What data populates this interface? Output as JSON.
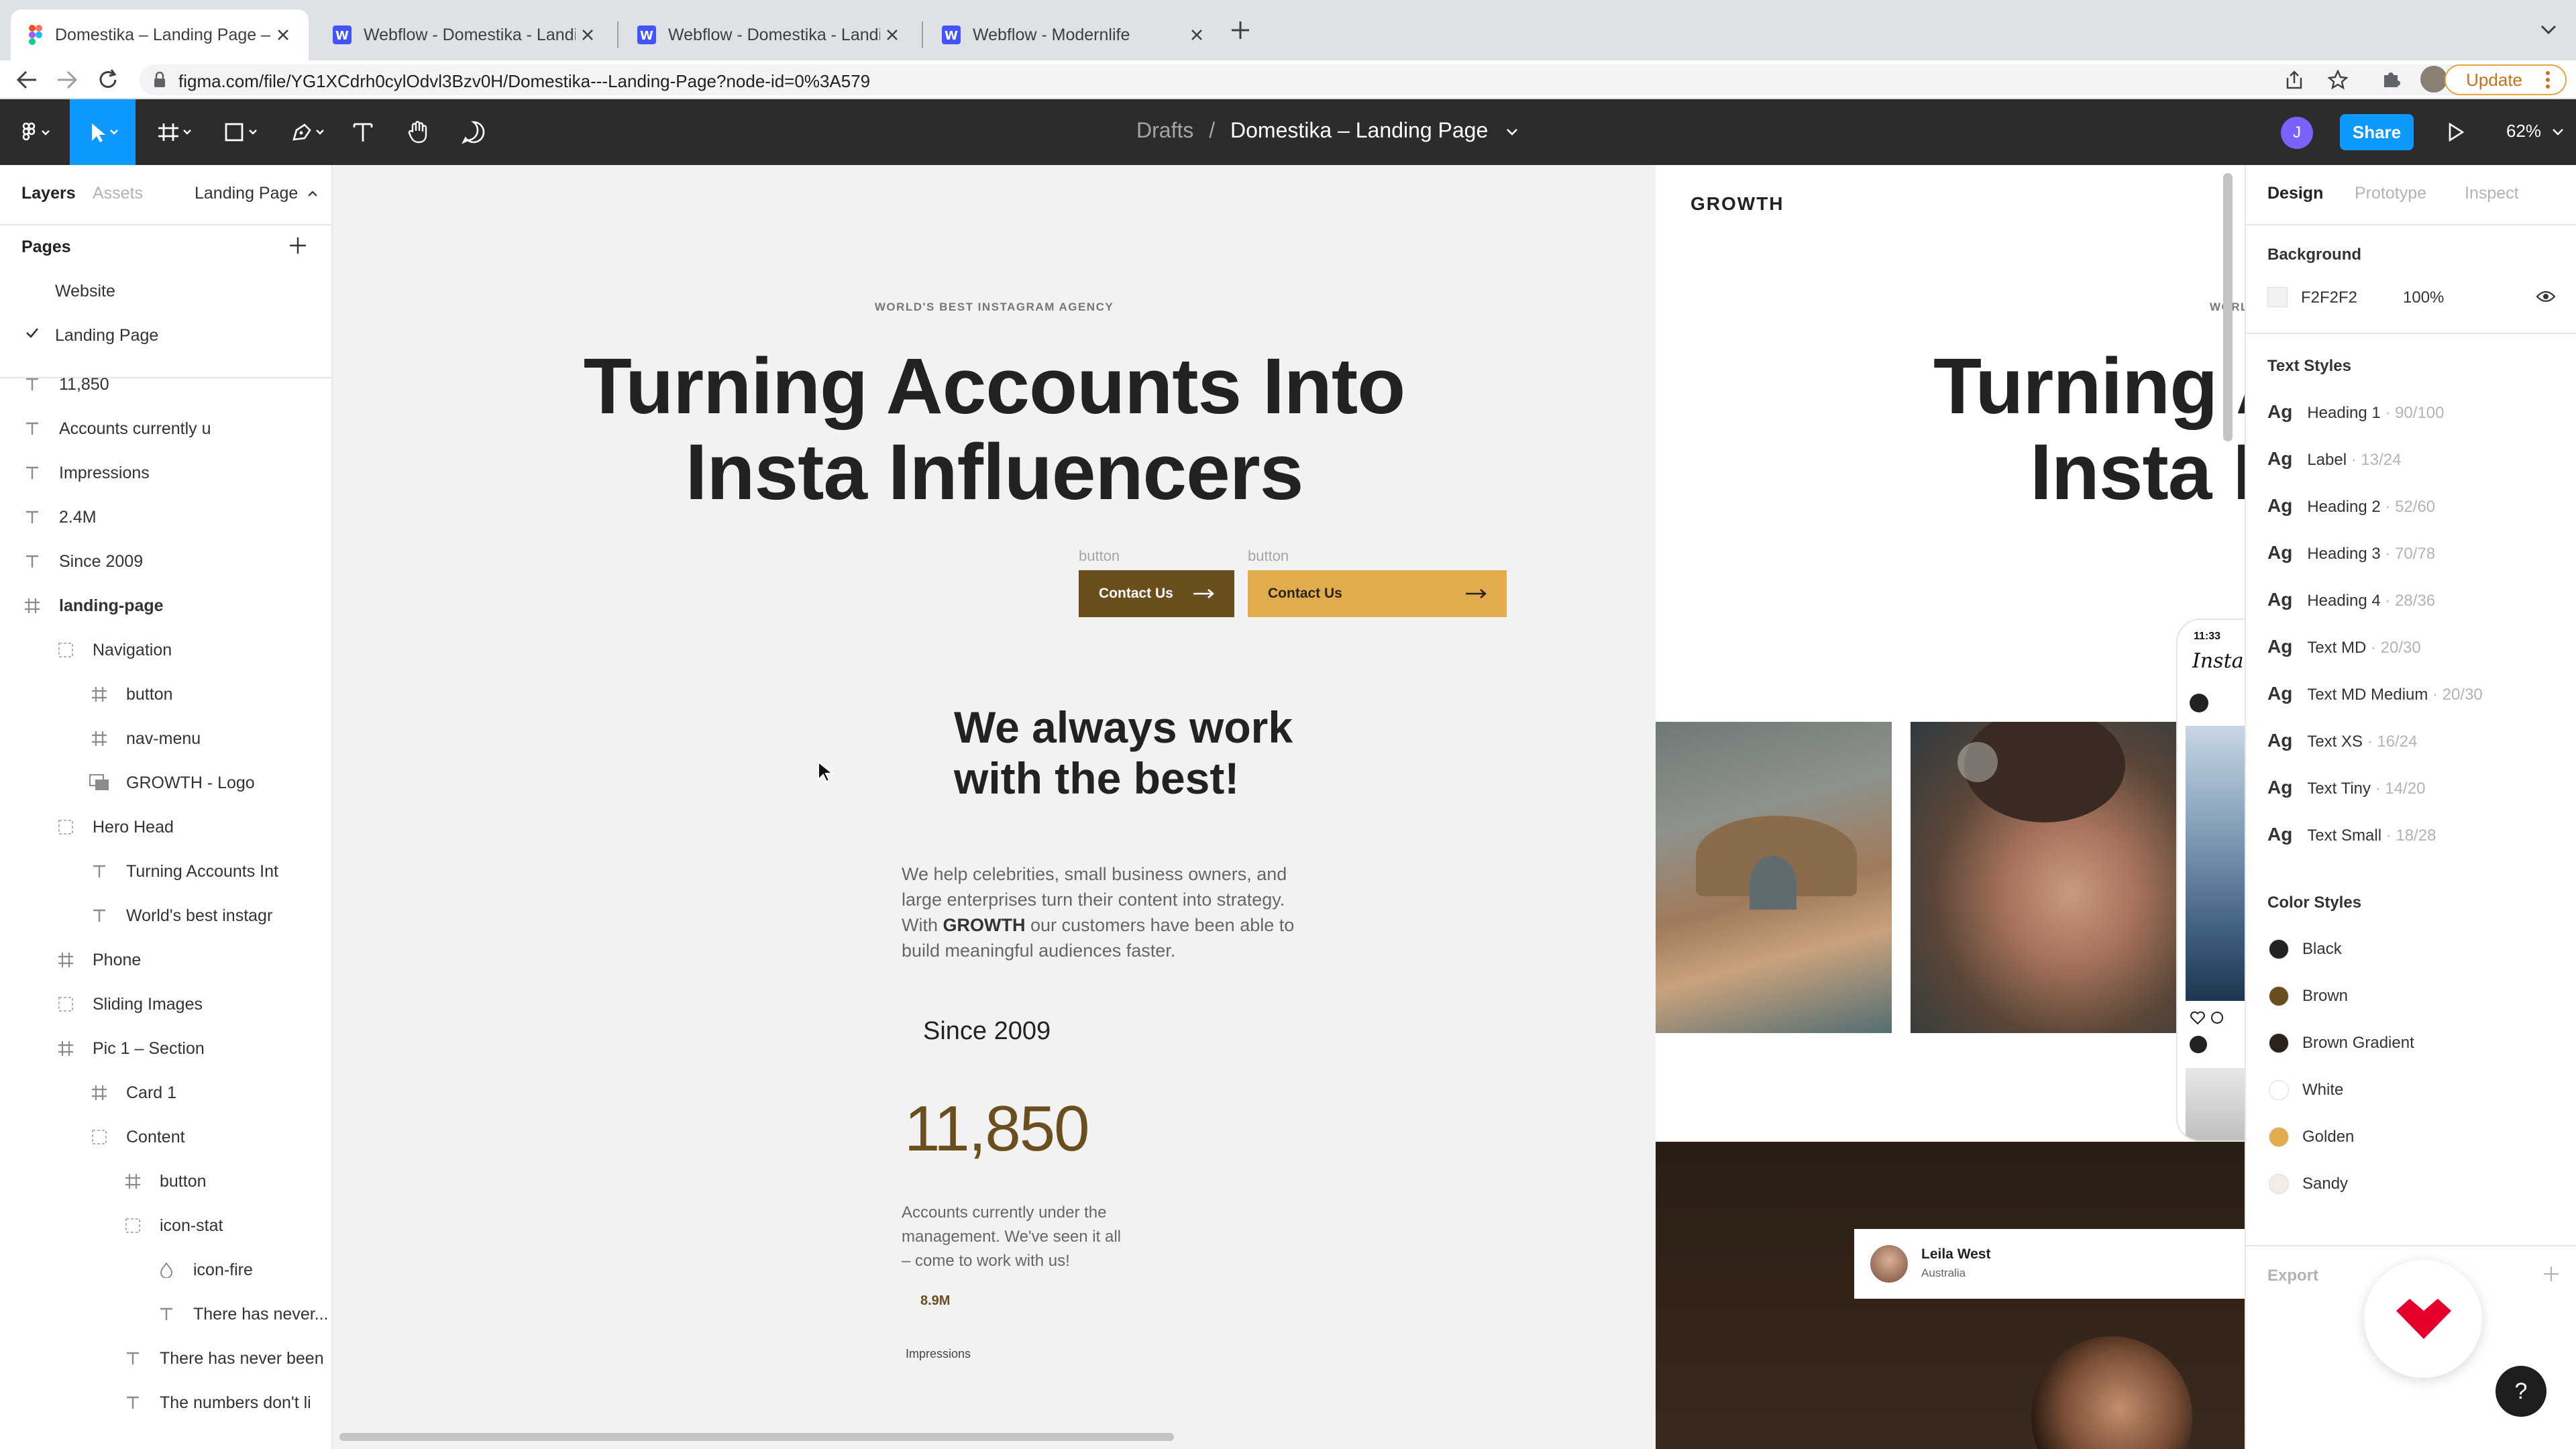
{
  "browser": {
    "tabs": [
      {
        "title": "Domestika – Landing Page – Fi",
        "active": true
      },
      {
        "title": "Webflow - Domestika - Landin"
      },
      {
        "title": "Webflow - Domestika - Landin"
      },
      {
        "title": "Webflow - Modernlife"
      }
    ],
    "url": "figma.com/file/YG1XCdrh0cylOdvl3Bzv0H/Domestika---Landing-Page?node-id=0%3A579",
    "update_label": "Update"
  },
  "toolbar": {
    "drafts": "Drafts",
    "separator": "/",
    "file_name": "Domestika – Landing Page",
    "avatar_initial": "J",
    "share_label": "Share",
    "zoom": "62%"
  },
  "left_panel": {
    "tabs": {
      "layers": "Layers",
      "assets": "Assets",
      "page": "Landing Page"
    },
    "pages_title": "Pages",
    "pages": [
      "Website",
      "Landing Page"
    ],
    "layers": [
      {
        "name": "11,850",
        "type": "text"
      },
      {
        "name": "Accounts currently u",
        "type": "text"
      },
      {
        "name": "Impressions",
        "type": "text"
      },
      {
        "name": "2.4M",
        "type": "text"
      },
      {
        "name": "Since 2009",
        "type": "text"
      },
      {
        "name": "landing-page",
        "type": "frame"
      },
      {
        "name": "Navigation",
        "type": "group"
      },
      {
        "name": "button",
        "type": "frame"
      },
      {
        "name": "nav-menu",
        "type": "frame"
      },
      {
        "name": "GROWTH - Logo",
        "type": "image"
      },
      {
        "name": "Hero Head",
        "type": "group"
      },
      {
        "name": "Turning Accounts Int",
        "type": "text"
      },
      {
        "name": "World's best instagr",
        "type": "text"
      },
      {
        "name": "Phone",
        "type": "frame"
      },
      {
        "name": "Sliding Images",
        "type": "group"
      },
      {
        "name": "Pic 1 – Section",
        "type": "frame"
      },
      {
        "name": "Card 1",
        "type": "frame"
      },
      {
        "name": "Content",
        "type": "group"
      },
      {
        "name": "button",
        "type": "frame"
      },
      {
        "name": "icon-stat",
        "type": "group"
      },
      {
        "name": "icon-fire",
        "type": "vector"
      },
      {
        "name": "There has never...",
        "type": "text"
      },
      {
        "name": "There has never been",
        "type": "text"
      },
      {
        "name": "The numbers don't li",
        "type": "text"
      }
    ]
  },
  "canvas": {
    "eyebrow": "WORLD'S BEST INSTAGRAM AGENCY",
    "hero_line1": "Turning Accounts Into",
    "hero_line2": "Insta Influencers",
    "button_label_small": "button",
    "contact_label": "Contact Us",
    "sub_line1": "We always work",
    "sub_line2": "with the best!",
    "body_l1": "We help celebrities, small business owners, and",
    "body_l2": "large enterprises turn their content into strategy.",
    "body_l3_pre": "With",
    "body_l3_bold": "GROWTH",
    "body_l3_post": "our customers have been able to",
    "body_l4": "build meaningful audiences faster.",
    "since": "Since 2009",
    "big_stat": "11,850",
    "stat_desc1": "Accounts currently under the",
    "stat_desc2": "management. We've seen it all",
    "stat_desc3": "– come to work with us!",
    "small_stat": "8.9M",
    "impressions": "Impressions",
    "logo": "GROWTH",
    "hero2_line1": "Turning A",
    "hero2_line2": "Insta I",
    "eyebrow2": "WORL",
    "phone_time": "11:33",
    "phone_app": "Insta",
    "card_name": "Leila West",
    "card_location": "Australia"
  },
  "right_panel": {
    "tabs": {
      "design": "Design",
      "prototype": "Prototype",
      "inspect": "Inspect"
    },
    "background_title": "Background",
    "bg_hex": "F2F2F2",
    "bg_opacity": "100%",
    "text_styles_title": "Text Styles",
    "text_styles": [
      {
        "name": "Heading 1",
        "meta": "· 90/100"
      },
      {
        "name": "Label",
        "meta": "· 13/24"
      },
      {
        "name": "Heading 2",
        "meta": "· 52/60"
      },
      {
        "name": "Heading 3",
        "meta": "· 70/78"
      },
      {
        "name": "Heading 4",
        "meta": "· 28/36"
      },
      {
        "name": "Text MD",
        "meta": "· 20/30"
      },
      {
        "name": "Text MD Medium",
        "meta": "· 20/30"
      },
      {
        "name": "Text XS",
        "meta": "· 16/24"
      },
      {
        "name": "Text Tiny",
        "meta": "· 14/20"
      },
      {
        "name": "Text Small",
        "meta": "· 18/28"
      }
    ],
    "ag": "Ag",
    "color_styles_title": "Color Styles",
    "color_styles": [
      {
        "name": "Black",
        "color": "#222222"
      },
      {
        "name": "Brown",
        "color": "#6b4e1e"
      },
      {
        "name": "Brown Gradient",
        "color": "#2a2418"
      },
      {
        "name": "White",
        "color": "#ffffff"
      },
      {
        "name": "Golden",
        "color": "#e2ac4d"
      },
      {
        "name": "Sandy",
        "color": "#f2ede4"
      }
    ],
    "export_title": "Export",
    "help": "?"
  },
  "colors": {
    "figma_blue": "#0d99ff",
    "brown": "#6b4e1e",
    "golden": "#e2ac4d",
    "toolbar": "#2c2c2c"
  }
}
